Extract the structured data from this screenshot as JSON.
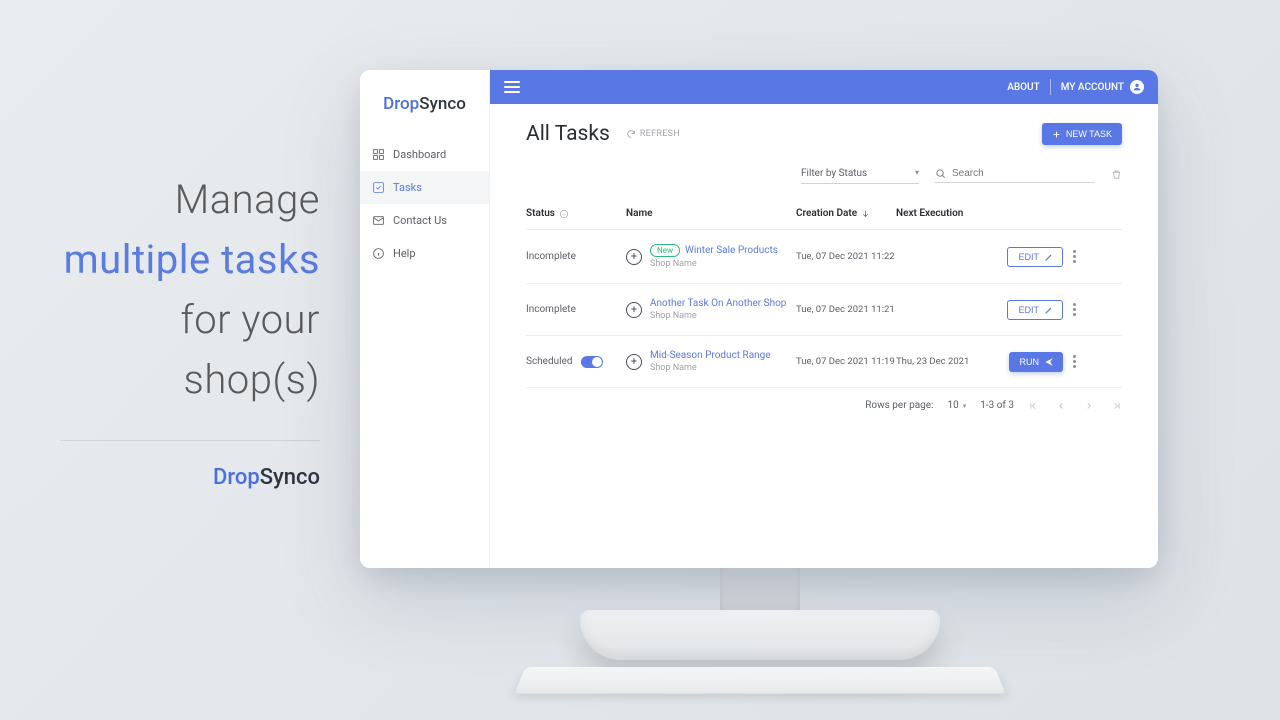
{
  "promo": {
    "line1": "Manage",
    "line2": "multiple tasks",
    "line3": "for  your",
    "line4": "shop(s)",
    "logo_drop": "Drop",
    "logo_sync": "Synco"
  },
  "logo": {
    "drop": "Drop",
    "sync": "Synco"
  },
  "sidebar": {
    "items": [
      {
        "icon": "grid-icon",
        "label": "Dashboard"
      },
      {
        "icon": "checkbox-icon",
        "label": "Tasks"
      },
      {
        "icon": "mail-icon",
        "label": "Contact Us"
      },
      {
        "icon": "info-icon",
        "label": "Help"
      }
    ]
  },
  "topbar": {
    "about": "ABOUT",
    "my_account": "MY ACCOUNT"
  },
  "page": {
    "title": "All Tasks",
    "refresh": "REFRESH",
    "new_task": "NEW TASK"
  },
  "filters": {
    "by_status": "Filter by Status",
    "search_placeholder": "Search"
  },
  "table": {
    "headers": {
      "status": "Status",
      "name": "Name",
      "creation": "Creation Date",
      "next_exec": "Next Execution"
    },
    "rows": [
      {
        "status": "Incomplete",
        "has_toggle": false,
        "new_badge": "New",
        "task_name": "Winter Sale Products",
        "shop": "Shop Name",
        "creation": "Tue, 07 Dec 2021 11:22",
        "next_exec": "",
        "action": "EDIT"
      },
      {
        "status": "Incomplete",
        "has_toggle": false,
        "new_badge": "",
        "task_name": "Another Task On Another Shop",
        "shop": "Shop Name",
        "creation": "Tue, 07 Dec 2021 11:21",
        "next_exec": "",
        "action": "EDIT"
      },
      {
        "status": "Scheduled",
        "has_toggle": true,
        "new_badge": "",
        "task_name": "Mid-Season Product Range",
        "shop": "Shop Name",
        "creation": "Tue, 07 Dec 2021 11:19",
        "next_exec": "Thu, 23 Dec 2021",
        "action": "RUN"
      }
    ]
  },
  "pagination": {
    "rows_label": "Rows per page:",
    "rows_value": "10",
    "range": "1-3 of 3"
  }
}
